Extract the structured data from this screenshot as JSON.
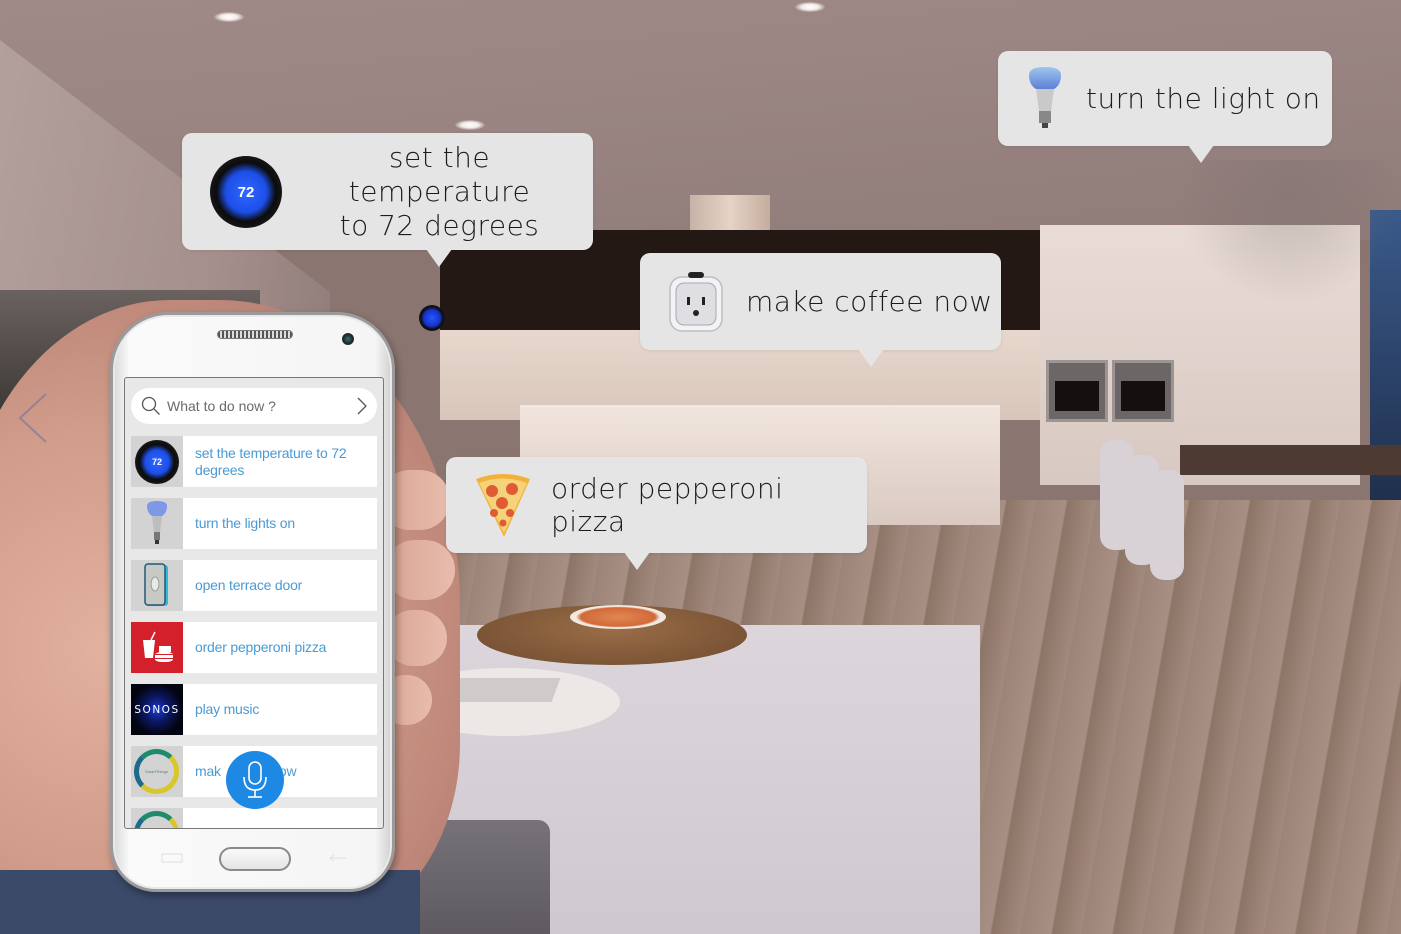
{
  "scene": {
    "description": "smart home living room with kitchen",
    "carousel_prev_icon": "chevron-left-icon"
  },
  "bubbles": {
    "temperature": {
      "icon": "nest-thermostat-icon",
      "icon_value": "72",
      "text": "set the temperature to 72 degrees",
      "line1": "set the temperature",
      "line2": "to 72 degrees"
    },
    "light": {
      "icon": "smart-bulb-icon",
      "text": "turn the light on"
    },
    "coffee": {
      "icon": "smart-plug-icon",
      "text": "make coffee now"
    },
    "pizza": {
      "icon": "pizza-slice-icon",
      "text": "order pepperoni pizza"
    }
  },
  "phone": {
    "search": {
      "placeholder": "What to do now ?",
      "value": "",
      "search_icon": "search-icon",
      "go_icon": "chevron-right-icon"
    },
    "list": [
      {
        "icon": "nest-thermostat-icon",
        "icon_text": "72",
        "label": "set the temperature to 72 degrees"
      },
      {
        "icon": "smart-bulb-icon",
        "label": "turn the lights on"
      },
      {
        "icon": "smart-lock-icon",
        "label": "open terrace door"
      },
      {
        "icon": "food-delivery-icon",
        "label": "order pepperoni pizza"
      },
      {
        "icon": "sonos-icon",
        "icon_text": "SONOS",
        "label": "play music"
      },
      {
        "icon": "smartthings-icon",
        "icon_text": "SmartThings",
        "label_left": "mak",
        "label_right": "ow"
      },
      {
        "icon": "smartthings-icon",
        "label": ""
      }
    ],
    "mic_icon": "microphone-icon"
  },
  "colors": {
    "bubble_bg": "#e5e5e5",
    "list_text": "#4a9ad4",
    "mic_button": "#1e88e5",
    "food_red": "#d4202b"
  }
}
